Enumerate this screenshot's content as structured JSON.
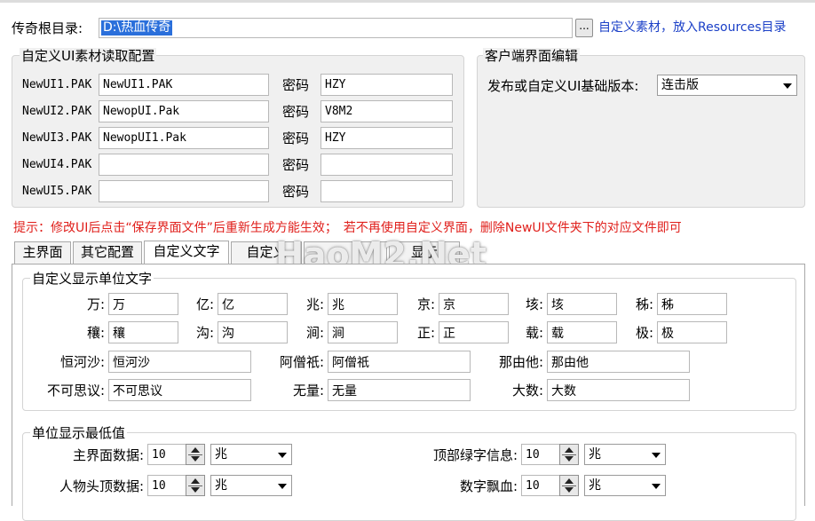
{
  "top": {
    "root_label": "传奇根目录:",
    "root_value": "D:\\热血传奇",
    "browse_label": "...",
    "hint": "自定义素材，放入Resources目录"
  },
  "ui_config": {
    "title": "自定义UI素材读取配置",
    "password_label": "密码",
    "rows": [
      {
        "name": "NewUI1.PAK",
        "file": "NewUI1.PAK",
        "password": "HZY"
      },
      {
        "name": "NewUI2.PAK",
        "file": "NewopUI.Pak",
        "password": "V8M2"
      },
      {
        "name": "NewUI3.PAK",
        "file": "NewopUI1.Pak",
        "password": "HZY"
      },
      {
        "name": "NewUI4.PAK",
        "file": "",
        "password": ""
      },
      {
        "name": "NewUI5.PAK",
        "file": "",
        "password": ""
      }
    ]
  },
  "client_edit": {
    "title": "客户端界面编辑",
    "version_label": "发布或自定义UI基础版本:",
    "version_value": "连击版"
  },
  "tip": "提示：修改UI后点击“保存界面文件”后重新生成方能生效；　若不再使用自定义界面，删除NewUI文件夹下的对应文件即可",
  "tabs": [
    "主界面",
    "其它配置",
    "自定义文字",
    "自定义",
    "",
    "显示"
  ],
  "watermark": "HaoM2.Net",
  "unit_text": {
    "title": "自定义显示单位文字",
    "row1": [
      {
        "label": "万:",
        "value": "万"
      },
      {
        "label": "亿:",
        "value": "亿"
      },
      {
        "label": "兆:",
        "value": "兆"
      },
      {
        "label": "京:",
        "value": "京"
      },
      {
        "label": "垓:",
        "value": "垓"
      },
      {
        "label": "秭:",
        "value": "秭"
      }
    ],
    "row2": [
      {
        "label": "穰:",
        "value": "穰"
      },
      {
        "label": "沟:",
        "value": "沟"
      },
      {
        "label": "涧:",
        "value": "涧"
      },
      {
        "label": "正:",
        "value": "正"
      },
      {
        "label": "载:",
        "value": "载"
      },
      {
        "label": "极:",
        "value": "极"
      }
    ],
    "row3": [
      {
        "label": "恒河沙:",
        "value": "恒河沙"
      },
      {
        "label": "阿僧祇:",
        "value": "阿僧祇"
      },
      {
        "label": "那由他:",
        "value": "那由他"
      }
    ],
    "row4": [
      {
        "label": "不可思议:",
        "value": "不可思议"
      },
      {
        "label": "无量:",
        "value": "无量"
      },
      {
        "label": "大数:",
        "value": "大数"
      }
    ]
  },
  "min_values": {
    "title": "单位显示最低值",
    "rows": [
      {
        "label": "主界面数据:",
        "value": "10",
        "unit": "兆"
      },
      {
        "label": "顶部绿字信息:",
        "value": "10",
        "unit": "兆"
      },
      {
        "label": "人物头顶数据:",
        "value": "10",
        "unit": "兆"
      },
      {
        "label": "数字飘血:",
        "value": "10",
        "unit": "兆"
      }
    ]
  },
  "colors": {
    "accent_blue": "#1a3fc7",
    "tip_red": "#e0201c",
    "selection": "#2a6fdb"
  }
}
